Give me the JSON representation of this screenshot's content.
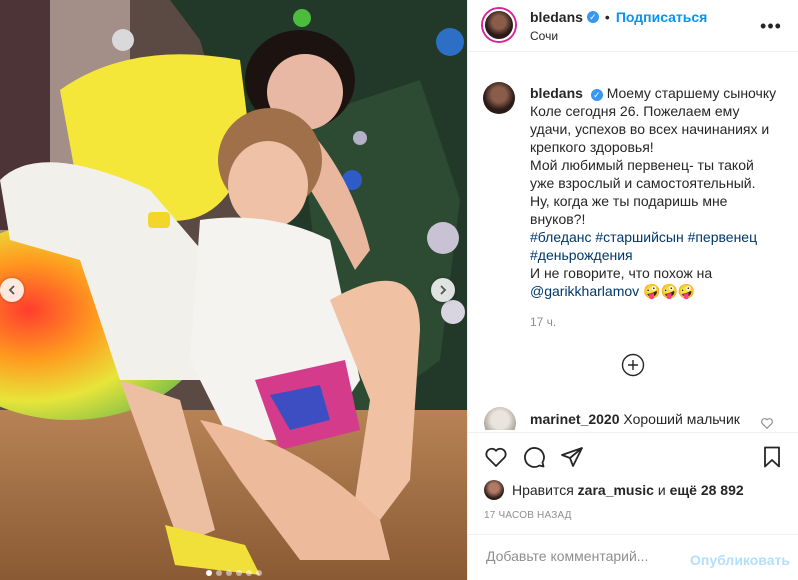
{
  "header": {
    "username": "bledans",
    "separator": "•",
    "follow_label": "Подписаться",
    "location": "Сочи",
    "more_icon": "more-horizontal-icon"
  },
  "caption": {
    "username": "bledans",
    "text_lines": [
      "Моему старшему сыночку",
      "Коле сегодня 26. Пожелаем ему",
      "удачи, успехов во всех начинаниях и",
      "крепкого здоровья!",
      "Мой любимый первенец- ты такой",
      "уже взрослый и самостоятельный.",
      "Ну, когда же ты подаришь мне",
      "внуков?!"
    ],
    "hashtags_line1": "#бледанс #старшийсын #первенец",
    "hashtags_line2": "#деньрождения",
    "closing_line": "И не говорите, что похож на",
    "mention": "@garikkharlamov",
    "emojis": "🤪🤪🤪",
    "time_ago": "17 ч."
  },
  "comment": {
    "username": "marinet_2020",
    "text": "Хороший мальчик"
  },
  "likes": {
    "prefix": "Нравится",
    "user": "zara_music",
    "middle": "и",
    "others": "ещё 28 892"
  },
  "timestamp": "17 часов назад",
  "add_comment": {
    "placeholder": "Добавьте комментарий...",
    "publish_label": "Опубликовать"
  },
  "carousel": {
    "dot_count": 6,
    "active_index": 0
  },
  "colors": {
    "accent": "#0095f6",
    "text": "#262626",
    "muted": "#8e8e8e",
    "publish_disabled": "#b2dffc",
    "hashtag": "#00376b"
  }
}
